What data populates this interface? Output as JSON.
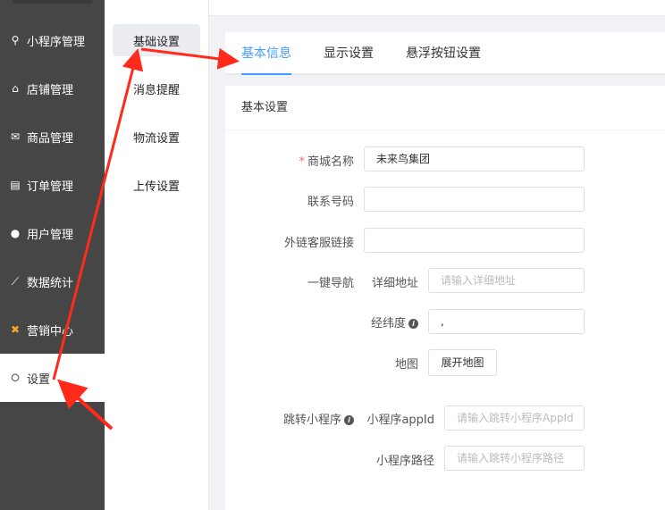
{
  "sidebar": {
    "items": [
      {
        "label": "小程序管理",
        "icon": "link-icon"
      },
      {
        "label": "店铺管理",
        "icon": "store-icon"
      },
      {
        "label": "商品管理",
        "icon": "goods-icon"
      },
      {
        "label": "订单管理",
        "icon": "order-icon"
      },
      {
        "label": "用户管理",
        "icon": "user-icon"
      },
      {
        "label": "数据统计",
        "icon": "chart-icon"
      },
      {
        "label": "营销中心",
        "icon": "marketing-icon"
      },
      {
        "label": "设置",
        "icon": "gear-icon"
      }
    ],
    "active": "设置"
  },
  "submenu": {
    "items": [
      "基础设置",
      "消息提醒",
      "物流设置",
      "上传设置"
    ],
    "active": "基础设置"
  },
  "tabs": [
    "基本信息",
    "显示设置",
    "悬浮按钮设置"
  ],
  "section_title": "基本设置",
  "form": {
    "shop_name_label": "商城名称",
    "shop_name_value": "未来鸟集团",
    "phone_label": "联系号码",
    "service_link_label": "外链客服链接",
    "nav_label": "一键导航",
    "address_label": "详细地址",
    "address_placeholder": "请输入详细地址",
    "latlng_label": "经纬度",
    "latlng_value": ",",
    "map_label": "地图",
    "map_button": "展开地图",
    "jump_label": "跳转小程序",
    "appid_label": "小程序appId",
    "appid_placeholder": "请输入跳转小程序AppId",
    "path_label": "小程序路径",
    "path_placeholder": "请输入跳转小程序路径"
  },
  "colors": {
    "accent": "#409eff",
    "sidebar": "#464646",
    "arrow": "#ff2a1a"
  }
}
